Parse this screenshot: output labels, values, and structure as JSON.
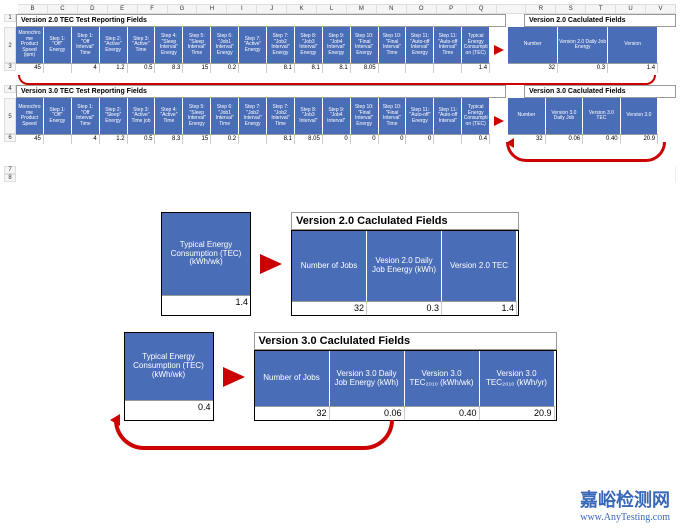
{
  "columnLetters": [
    "B",
    "C",
    "D",
    "E",
    "F",
    "G",
    "H",
    "I",
    "J",
    "K",
    "L",
    "M",
    "N",
    "O",
    "P",
    "Q",
    "",
    "R",
    "S",
    "T",
    "U",
    "V"
  ],
  "top": {
    "v2": {
      "title": "Version 2.0 TEC Test Reporting Fields",
      "calcTitle": "Version 2.0 Caclulated Fields",
      "headers": [
        "Monochrome Product Speed (ipm)",
        "Step 1: \"Off\" Energy",
        "Step 1: \"Off Interval\" Time",
        "Step 2: \"Active\" Energy",
        "Step 3: \"Active\" Time",
        "Step 4: \"Sleep Interval\" Energy",
        "Step 5: \"Sleep Interval\" Time",
        "Step 6: \"Job1 Interval\" Energy",
        "Step 7: \"Active\" Energy",
        "Step 7: \"Job2 Interval\" Energy",
        "Step 8: \"Job3 Interval\" Energy",
        "Step 9: \"Job4 Interval\" Energy",
        "Step 10: \"Final Interval\" Energy",
        "Step 10: \"Final Interval\" Time",
        "Step 11: \"Auto-off Interval\" Energy",
        "Step 11: \"Auto-off Interval\" Time",
        "Typical Energy Consumption (TEC)"
      ],
      "values": [
        "45",
        "",
        "4",
        "1.2",
        "0.5",
        "8.3",
        "15",
        "0.2",
        "",
        "8.1",
        "8.1",
        "8.1",
        "8.05",
        "",
        "",
        "",
        "1.4"
      ],
      "calcHeaders": [
        "Number",
        "Version 2.0 Daily Job Energy",
        "Version"
      ],
      "calcValues": [
        "32",
        "0.3",
        "1.4"
      ]
    },
    "v3": {
      "title": "Version 3.0 TEC Test Reporting Fields",
      "calcTitle": "Version 3.0 Caclulated Fields",
      "headers": [
        "Monochrome Product Speed",
        "Step 1: \"Off\" Energy",
        "Step 1: \"Off Interval\" Time",
        "Step 2: \"Sleep\" Energy",
        "Step 3: \"Active\" Time job",
        "Step 4: \"Active\" Time",
        "Step 5: \"Sleep Interval\" Energy",
        "Step 6: \"Job1 Interval\" Time",
        "Step 7: \"Job2 Interval\" Energy",
        "Step 7: \"Job2 Interval\" Time",
        "Step 8: \"Job3 Interval\"",
        "Step 9: \"Job4 Interval\"",
        "Step 10: \"Final Interval\" Energy",
        "Step 10: \"Final Interval\" Time",
        "Step 11: \"Auto-off\" Energy",
        "Step 11: \"Auto-off Interval\"",
        "Typical Energy Consumption (TEC)"
      ],
      "values": [
        "45",
        "",
        "4",
        "1.2",
        "0.5",
        "8.3",
        "15",
        "0.2",
        "",
        "8.1",
        "8.05",
        "0",
        "0",
        "0",
        "0",
        "",
        "0.4"
      ],
      "calcHeaders": [
        "Number",
        "Version 3.0 Daily Job",
        "Version 3.0 TEC",
        "Version 3.0"
      ],
      "calcValues": [
        "32",
        "0.06",
        "0.40",
        "20.9"
      ]
    }
  },
  "bottom": {
    "v2": {
      "tecLabel": "Typical Energy Consumption (TEC) (kWh/wk)",
      "tecValue": "1.4",
      "title": "Version 2.0 Caclulated Fields",
      "headers": [
        "Number of Jobs",
        "Vesion 2.0 Daily Job Energy (kWh)",
        "Version 2.0 TEC"
      ],
      "values": [
        "32",
        "0.3",
        "1.4"
      ]
    },
    "v3": {
      "tecLabel": "Typical Energy Consumption (TEC) (kWh/wk)",
      "tecValue": "0.4",
      "title": "Version 3.0 Caclulated Fields",
      "headers": [
        "Number of Jobs",
        "Version 3.0 Daily Job Energy (kWh)",
        "Version 3.0 TEC₂₀₁₀ (kWh/wk)",
        "Version 3.0 TEC₂₀₁₀ (kWh/yr)"
      ],
      "values": [
        "32",
        "0.06",
        "0.40",
        "20.9"
      ]
    }
  },
  "watermark": {
    "cn": "嘉峪检测网",
    "en": "www.AnyTesting.com"
  }
}
